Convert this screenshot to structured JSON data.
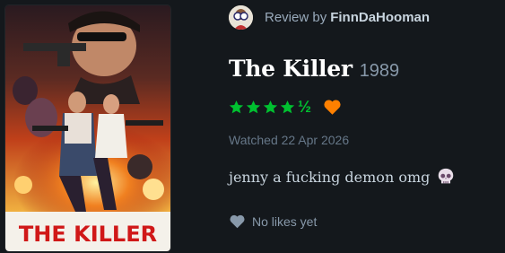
{
  "poster": {
    "caption": "THE KILLER"
  },
  "review": {
    "label": "Review by",
    "username": "FinnDaHooman",
    "film_title": "The Killer",
    "film_year": "1989",
    "rating_stars": 4.5,
    "rating_half_glyph": "½",
    "liked": true,
    "watched": "Watched 22 Apr 2026",
    "text": "jenny a fucking demon omg",
    "emoji": "skull-icon",
    "likes": "No likes yet"
  },
  "colors": {
    "background": "#14181c",
    "star_green": "#00c030",
    "like_orange": "#ff8000",
    "muted": "#8899aa"
  }
}
